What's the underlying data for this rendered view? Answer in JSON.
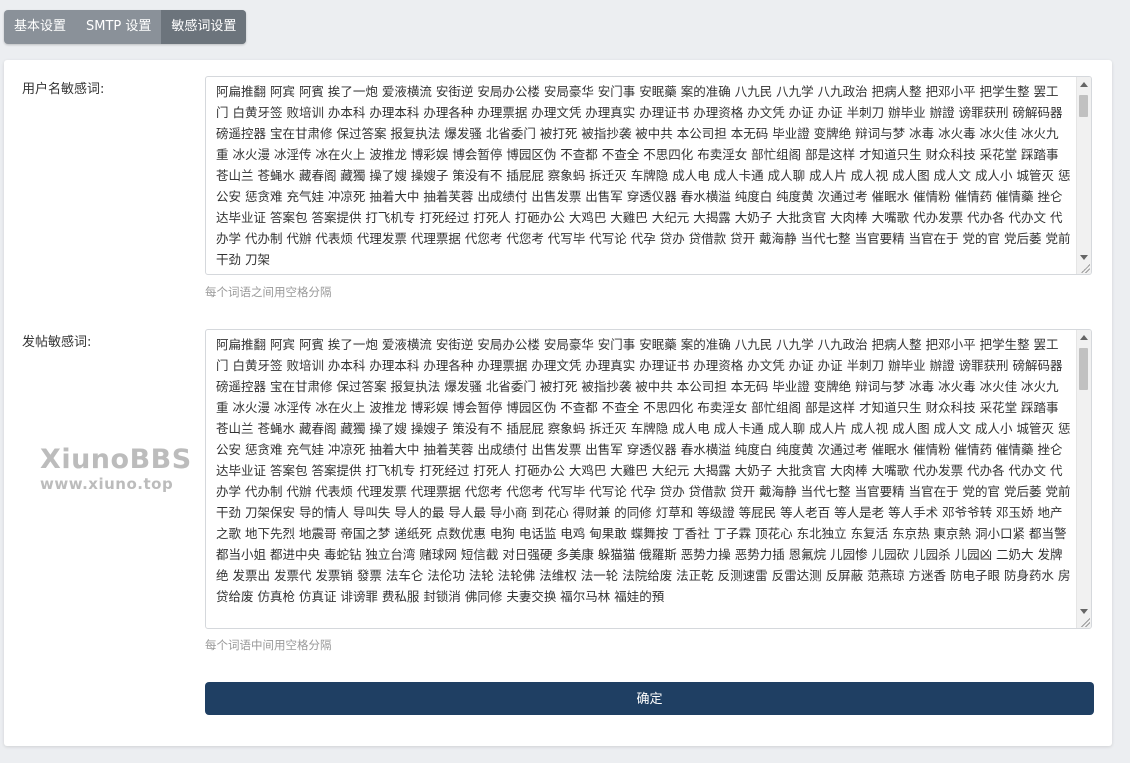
{
  "tabs": [
    {
      "label": "基本设置",
      "active": false
    },
    {
      "label": "SMTP 设置",
      "active": false
    },
    {
      "label": "敏感词设置",
      "active": true
    }
  ],
  "username_filter": {
    "label": "用户名敏感词:",
    "value": "阿扁推翻 阿宾 阿賓 挨了一炮 爱液横流 安街逆 安局办公楼 安局豪华 安门事 安眠藥 案的准确 八九民 八九学 八九政治 把病人整 把邓小平 把学生整 罢工门 白黄牙签 败培训 办本科 办理本科 办理各种 办理票据 办理文凭 办理真实 办理证书 办理资格 办文凭 办证 办证 半刺刀 辦毕业 辦證 谤罪获刑 磅解码器 磅遥控器 宝在甘肃修 保过答案 报复执法 爆发骚 北省委门 被打死 被指抄袭 被中共 本公司担 本无码 毕业證 变牌绝 辩词与梦 冰毒 冰火毒 冰火佳 冰火九重 冰火漫 冰淫传 冰在火上 波推龙 博彩娱 博会暂停 博园区伪 不查都 不查全 不思四化 布卖淫女 部忙组阁 部是这样 才知道只生 财众科技 采花堂 踩踏事 苍山兰 苍蝇水 藏春阁 藏獨 操了嫂 操嫂子 策没有不 插屁屁 察象蚂 拆迁灭 车牌隐 成人电 成人卡通 成人聊 成人片 成人视 成人图 成人文 成人小 城管灭 惩公安 惩贪难 充气娃 冲凉死 抽着大中 抽着芙蓉 出成绩付 出售发票 出售军 穿透仪器 春水横溢 纯度白 纯度黄 次通过考 催眠水 催情粉 催情药 催情藥 挫仑 达毕业证 答案包 答案提供 打飞机专 打死经过 打死人 打砸办公 大鸡巴 大雞巴 大纪元 大揭露 大奶子 大批贪官 大肉棒 大嘴歌 代办发票 代办各 代办文 代办学 代办制 代辦 代表烦 代理发票 代理票据 代您考 代您考 代写毕 代写论 代孕 贷办 贷借款 贷开 戴海静 当代七整 当官要精 当官在于 党的官 党后萎 党前干劲 刀架"
  },
  "username_hint": "每个词语之间用空格分隔",
  "post_filter": {
    "label": "发帖敏感词:",
    "value": "阿扁推翻 阿宾 阿賓 挨了一炮 爱液横流 安街逆 安局办公楼 安局豪华 安门事 安眠藥 案的准确 八九民 八九学 八九政治 把病人整 把邓小平 把学生整 罢工门 白黄牙签 败培训 办本科 办理本科 办理各种 办理票据 办理文凭 办理真实 办理证书 办理资格 办文凭 办证 办证 半刺刀 辦毕业 辦證 谤罪获刑 磅解码器 磅遥控器 宝在甘肃修 保过答案 报复执法 爆发骚 北省委门 被打死 被指抄袭 被中共 本公司担 本无码 毕业證 变牌绝 辩词与梦 冰毒 冰火毒 冰火佳 冰火九重 冰火漫 冰淫传 冰在火上 波推龙 博彩娱 博会暂停 博园区伪 不查都 不查全 不思四化 布卖淫女 部忙组阁 部是这样 才知道只生 财众科技 采花堂 踩踏事 苍山兰 苍蝇水 藏春阁 藏獨 操了嫂 操嫂子 策没有不 插屁屁 察象蚂 拆迁灭 车牌隐 成人电 成人卡通 成人聊 成人片 成人视 成人图 成人文 成人小 城管灭 惩公安 惩贪难 充气娃 冲凉死 抽着大中 抽着芙蓉 出成绩付 出售发票 出售军 穿透仪器 春水横溢 纯度白 纯度黄 次通过考 催眠水 催情粉 催情药 催情藥 挫仑 达毕业证 答案包 答案提供 打飞机专 打死经过 打死人 打砸办公 大鸡巴 大雞巴 大纪元 大揭露 大奶子 大批贪官 大肉棒 大嘴歌 代办发票 代办各 代办文 代办学 代办制 代辦 代表烦 代理发票 代理票据 代您考 代您考 代写毕 代写论 代孕 贷办 贷借款 贷开 戴海静 当代七整 当官要精 当官在于 党的官 党后萎 党前干劲 刀架保安 导的情人 导叫失 导人的最 导人最 导小商 到花心 得财兼 的同修 灯草和 等级證 等屁民 等人老百 等人是老 等人手术 邓爷爷转 邓玉娇 地产之歌 地下先烈 地震哥 帝国之梦 递纸死 点数优惠 电狗 电话监 电鸡 甸果敢 蝶舞按 丁香社 丁子霖 顶花心 东北独立 东复活 东京热 東京熱 洞小口紧 都当警 都当小姐 都进中央 毒蛇钻 独立台湾 赌球网 短信截 对日强硬 多美康 躲猫猫 俄羅斯 恶势力操 恶势力插 恩氟烷 儿园惨 儿园砍 儿园杀 儿园凶 二奶大 发牌绝 发票出 发票代 发票销 發票 法车仑 法伦功 法轮 法轮佛 法维权 法一轮 法院给废 法正乾 反测速雷 反雷达测 反屏蔽 范燕琼 方迷香 防电子眼 防身药水 房贷给废 仿真枪 仿真证 诽谤罪 费私服 封锁消 佛同修 夫妻交换 福尔马林 福娃的預"
  },
  "post_hint": "每个词语中间用空格分隔",
  "submit_label": "确定",
  "watermark": {
    "title": "XiunoBBS",
    "url": "www.xiuno.top"
  },
  "colors": {
    "tab_bg": "#8a9199",
    "tab_active": "#6c747c",
    "button": "#1f3f63",
    "page_bg": "#eceef1"
  }
}
